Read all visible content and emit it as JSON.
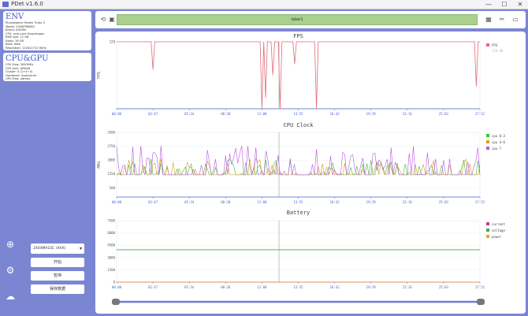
{
  "window": {
    "title": "PDet v1.6.0",
    "minimize": "—",
    "maximize": "☐",
    "close": "✕"
  },
  "env": {
    "heading": "ENV",
    "lines": [
      "PhoneName: Redmi Turbo 3",
      "Model: 2304FPN6DG",
      "Brand: XIAOMI",
      "CPU: octa-core Snapdragon",
      "RAM size: 12 GB",
      "Swap: 16 GB",
      "Root: false",
      "Resolution: 1220x2712 60Hz"
    ]
  },
  "cpugpu": {
    "heading": "CPU&GPU",
    "lines": [
      "CPU Freq: 3000MHz",
      "CPU arch: ARMv8",
      "Cluster: 3 (1+4+3)",
      "Hardware: Qualcomm",
      "GPU Freq: adreno"
    ]
  },
  "sidebar": {
    "add_icon": "⊕",
    "wrench_icon": "⚙",
    "upload_icon": "☁",
    "select_value": "2404MA1SC (XXX)",
    "buttons": [
      "开始",
      "暂停",
      "保存数据"
    ]
  },
  "toolbar": {
    "label": "label1",
    "left_icons": [
      "⟲",
      "▣"
    ],
    "right_icons": [
      "▦",
      "✂",
      "▭"
    ]
  },
  "colors": {
    "fps": "#e36b7a",
    "cpu0": "#3fbf3f",
    "cpu4": "#d6a21f",
    "cpu7": "#b857e0",
    "current": "#c43fa0",
    "voltage": "#4aa84a",
    "power": "#e2a23a",
    "axis": "#4a63d0"
  },
  "x_ticks": [
    "00:00",
    "02:47",
    "05:34",
    "08:20",
    "11:08",
    "13:55",
    "16:42",
    "19:29",
    "22:16",
    "25:03",
    "27:52"
  ],
  "chart_data": [
    {
      "type": "line",
      "title": "FPS",
      "ylabel": "FPS",
      "ylim": [
        0,
        120
      ],
      "y_ticks": [
        "120"
      ],
      "series": [
        {
          "name": "FPS",
          "baseline": 120,
          "dips": [
            [
              0.1,
              70
            ],
            [
              0.4,
              0
            ],
            [
              0.41,
              20
            ],
            [
              0.43,
              60
            ],
            [
              0.45,
              0
            ],
            [
              0.49,
              80
            ],
            [
              0.55,
              0
            ],
            [
              0.99,
              40
            ]
          ]
        }
      ],
      "legend_extra": "120.00"
    },
    {
      "type": "line",
      "title": "CPU Clock",
      "ylabel": "MHz",
      "ylim": [
        0,
        3500
      ],
      "y_ticks": [
        "3500",
        "2750",
        "2000",
        "1250",
        "500"
      ],
      "series": [
        {
          "name": "cpu 0-3",
          "baseline": 1200
        },
        {
          "name": "cpu 4-6",
          "baseline": 1200
        },
        {
          "name": "cpu 7",
          "baseline": 1200
        }
      ]
    },
    {
      "type": "line",
      "title": "Battery",
      "ylim": [
        0,
        7500
      ],
      "y_ticks": [
        "7500",
        "6000",
        "4500",
        "3000",
        "1500",
        "0"
      ],
      "series": [
        {
          "name": "current",
          "value": 0
        },
        {
          "name": "voltage",
          "value": 3950
        },
        {
          "name": "power",
          "value": 0
        }
      ]
    }
  ]
}
